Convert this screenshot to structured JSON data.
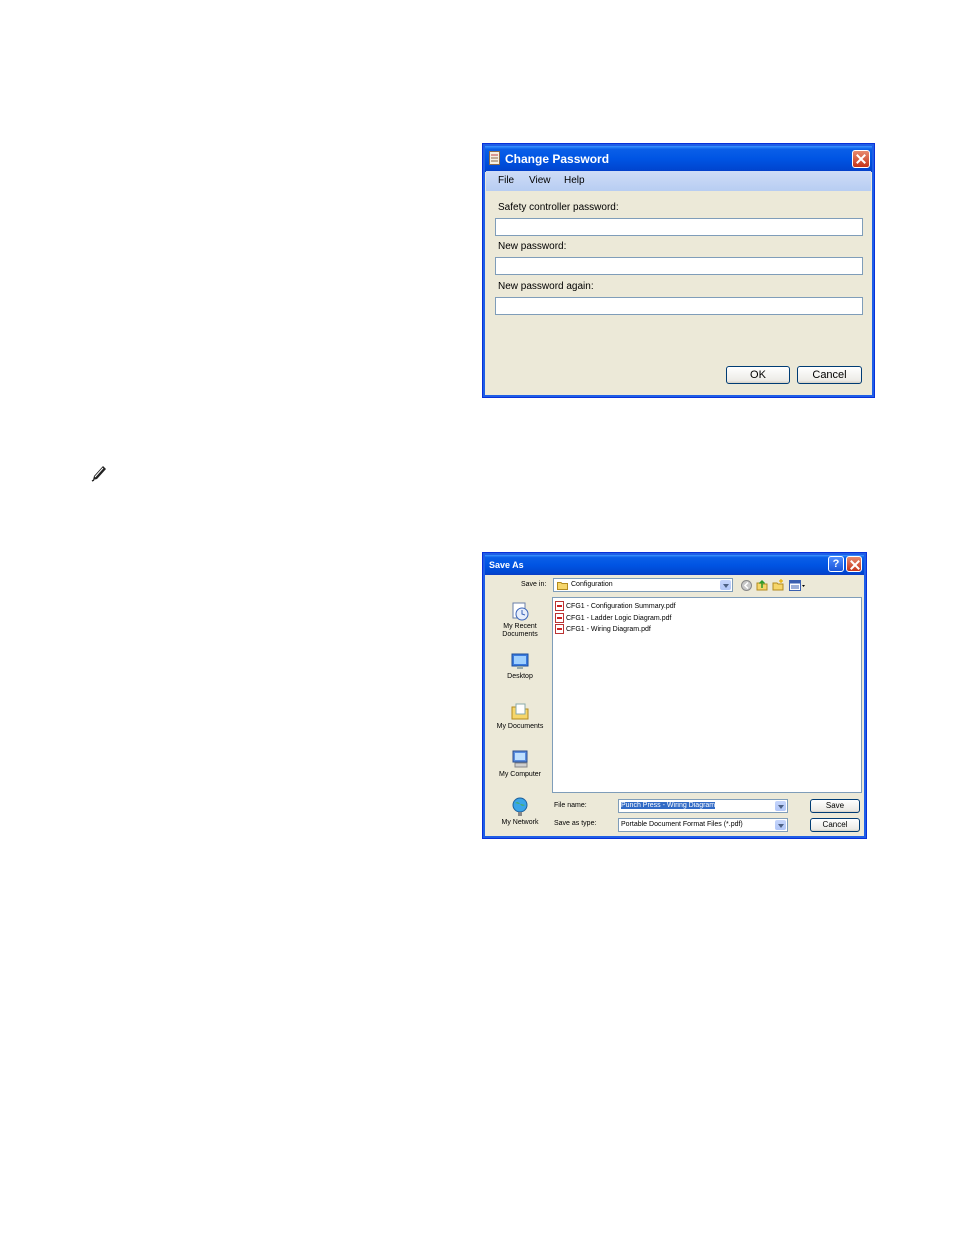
{
  "change_password": {
    "title": "Change Password",
    "menu": [
      "File",
      "View",
      "Help"
    ],
    "fields": [
      {
        "label": "Safety controller password:",
        "value": ""
      },
      {
        "label": "New password:",
        "value": ""
      },
      {
        "label": "New password again:",
        "value": ""
      }
    ],
    "ok_label": "OK",
    "cancel_label": "Cancel"
  },
  "save_as": {
    "title": "Save As",
    "save_in_label": "Save in:",
    "save_in_value": "Configuration",
    "places": [
      "My Recent Documents",
      "Desktop",
      "My Documents",
      "My Computer",
      "My Network"
    ],
    "files": [
      "CFG1 - Configuration Summary.pdf",
      "CFG1 - Ladder Logic Diagram.pdf",
      "CFG1 - Wiring Diagram.pdf"
    ],
    "file_name_label": "File name:",
    "file_name_value": "Punch Press - Wiring Diagram",
    "save_as_type_label": "Save as type:",
    "save_as_type_value": "Portable Document Format Files (*.pdf)",
    "save_label": "Save",
    "cancel_label": "Cancel",
    "help_glyph": "?"
  },
  "icons": {
    "note": "pencil-note-icon",
    "title_doc": "document-icon",
    "recent": "recent-documents-icon",
    "desktop": "desktop-icon",
    "documents": "my-documents-icon",
    "computer": "my-computer-icon",
    "network": "my-network-icon"
  }
}
